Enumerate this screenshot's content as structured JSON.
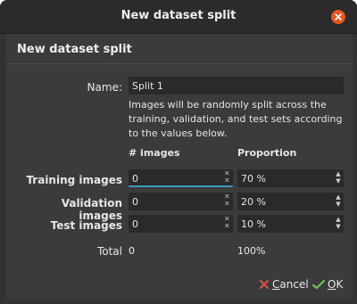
{
  "window": {
    "title": "New dataset split"
  },
  "header": {
    "section_title": "New dataset split"
  },
  "form": {
    "name_label": "Name:",
    "name_value": "Split 1",
    "description": "Images will be randomly split across the training, validation, and test sets according to the values below.",
    "col_images": "# images",
    "col_proportion": "Proportion",
    "rows": [
      {
        "label": "Training images",
        "images": "0",
        "proportion": "70 %"
      },
      {
        "label": "Validation images",
        "images": "0",
        "proportion": "20 %"
      },
      {
        "label": "Test images",
        "images": "0",
        "proportion": "10 %"
      }
    ],
    "total_label": "Total",
    "total_images": "0",
    "total_proportion": "100%"
  },
  "buttons": {
    "cancel_underline": "C",
    "cancel_rest": "ancel",
    "ok_underline": "O",
    "ok_rest": "K"
  },
  "colors": {
    "accent": "#3f97c4",
    "close": "#e95420",
    "cancel_icon": "#e05050",
    "ok_icon": "#6bbf59"
  },
  "icons": {
    "close": "close-icon",
    "cancel": "cancel-x-icon",
    "ok": "ok-check-icon"
  }
}
